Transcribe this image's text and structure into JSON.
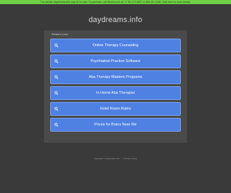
{
  "banner": {
    "text": "The domain daydreams.info may be for sale. To purchase, call Afternic.com at +1 781-373-6847 or 855-201-0286. Click here for more details."
  },
  "header": {
    "domain": "daydreams.info"
  },
  "panel": {
    "label": "Related Links",
    "links": [
      {
        "label": "Online Therapy Counseling",
        "icon": "search-icon"
      },
      {
        "label": "Psychiatrist Practice Software",
        "icon": "search-icon"
      },
      {
        "label": "Aba Therapy Masters Programs",
        "icon": "search-icon"
      },
      {
        "label": "In Home Aba Therapist",
        "icon": "search-icon"
      },
      {
        "label": "Hotel Room Rates",
        "icon": "search-icon"
      },
      {
        "label": "Prices for Botox Near Me",
        "icon": "search-icon"
      }
    ]
  },
  "footer": {
    "copyright": "Copyright © daydreams.info",
    "separator": "|",
    "privacy": "Privacy Policy"
  },
  "colors": {
    "background": "#3a3a3a",
    "panel": "#4a4a4a",
    "button": "#4f81e3",
    "banner": "#6fd043"
  }
}
